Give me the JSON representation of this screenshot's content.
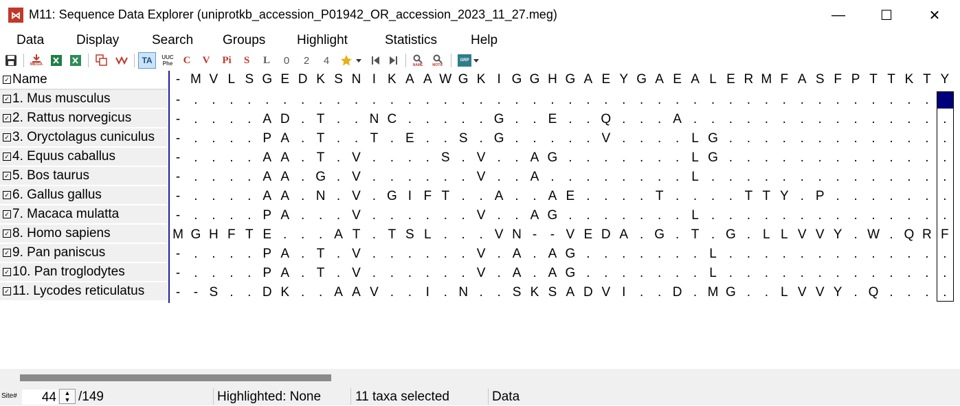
{
  "window": {
    "title": "M11: Sequence Data Explorer (uniprotkb_accession_P01942_OR_accession_2023_11_27.meg)",
    "icon_text": "⋈",
    "minimize": "—",
    "maximize": "☐",
    "close": "✕"
  },
  "menu": [
    "Data",
    "Display",
    "Search",
    "Groups",
    "Highlight",
    "Statistics",
    "Help"
  ],
  "toolbar": {
    "save_icon": "save-icon",
    "export_mega": "MEGA",
    "btn_C": "C",
    "btn_V": "V",
    "btn_Pi": "Pi",
    "btn_S": "S",
    "btn_L": "L",
    "btn_0": "0",
    "btn_2": "2",
    "btn_4": "4",
    "btn_ta": "TA",
    "btn_uuc": "UUC Phe",
    "btn_name": "NAME",
    "btn_motif": "MOTIF",
    "btn_grp": "GRP"
  },
  "name_header": "Name",
  "taxa": [
    "1. Mus musculus",
    "2. Rattus norvegicus",
    "3. Oryctolagus cuniculus",
    "4. Equus caballus",
    "5. Bos taurus",
    "6. Gallus gallus",
    "7. Macaca mulatta",
    "8. Homo sapiens",
    "9. Pan paniscus",
    "10. Pan troglodytes",
    "11. Lycodes reticulatus"
  ],
  "sequences": {
    "header": "-MVLSGEDKSNIKAAWGKIGGHGAEYGAEALERMFASFPTTKTY",
    "rows": [
      "---------------------------------------------",
      "-....AD.T..NC.....G..E..Q...A...............",
      "-....PA.T..T.E..S.G.....V....LG.............",
      "-....AA.T.V....S.V..AG.......LG.............",
      "-....AA.G.V......V..A........L..............",
      "-....AA.N.V.GIFT..A..AE....T....TTY.P.......",
      "-....PA...V......V..AG.......L..............",
      "MGHFTE...AT.TSL...VN--VEDA.G.T.G.LLVVY.W.QRF",
      "-....PA.T.V......V.A.AG.......L.............",
      "-....PA.T.V......V.A.AG.......L.............",
      "--S..DK..AAV..I.N..SKSADVI..D.MG..LVVY.Q...."
    ]
  },
  "status": {
    "site_label": "Site#",
    "site_value": "44",
    "site_total": "/149",
    "highlighted": "Highlighted: None",
    "selected": "11 taxa selected",
    "mode": "Data"
  },
  "colors": {
    "accent": "#c0392b",
    "selection": "#00007a",
    "divider": "#1a1aa0"
  }
}
